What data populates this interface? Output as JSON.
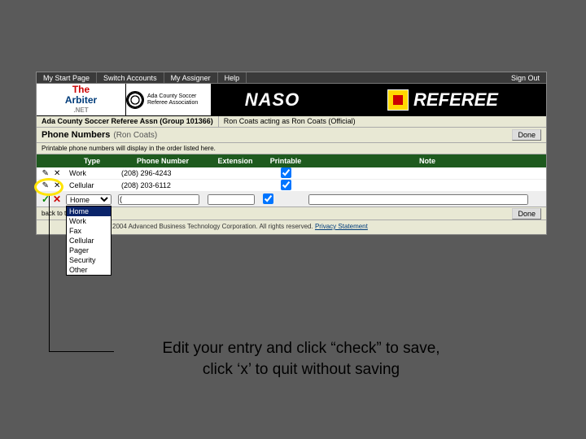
{
  "nav": {
    "items": [
      "My Start Page",
      "Switch Accounts",
      "My Assigner",
      "Help"
    ],
    "signout": "Sign Out"
  },
  "banner": {
    "arbiter_the": "The",
    "arbiter": "Arbiter",
    "net": ".NET",
    "ada": "Ada County Soccer Referee Association",
    "naso": "NASO",
    "referee": "REFEREE"
  },
  "crumb": {
    "left": "Ada County Soccer Referee Assn (Group 101366)",
    "right": "Ron Coats acting as Ron Coats (Official)"
  },
  "section": {
    "title": "Phone Numbers",
    "subtitle": "(Ron Coats)",
    "done": "Done",
    "note": "Printable phone numbers will display in the order listed here."
  },
  "headers": {
    "action": "",
    "type": "Type",
    "phone": "Phone Number",
    "ext": "Extension",
    "print": "Printable",
    "note": "Note"
  },
  "rows": [
    {
      "type": "Work",
      "phone": "(208) 296-4243",
      "ext": "",
      "print": true,
      "note": ""
    },
    {
      "type": "Cellular",
      "phone": "(208) 203-6112",
      "ext": "",
      "print": true,
      "note": ""
    }
  ],
  "edit": {
    "type_selected": "Home",
    "options": [
      "Home",
      "Work",
      "Fax",
      "Cellular",
      "Pager",
      "Security",
      "Other"
    ],
    "phone": "(",
    "ext": "",
    "print": true,
    "note": ""
  },
  "footer": {
    "back": "back to t",
    "done": "Done",
    "copyright": "© 2003 - 2004 Advanced Business Technology Corporation. All rights reserved.",
    "privacy": "Privacy Statement"
  },
  "caption": {
    "line1": "Edit your entry and click “check” to save,",
    "line2": "click ‘x’ to quit without saving"
  }
}
